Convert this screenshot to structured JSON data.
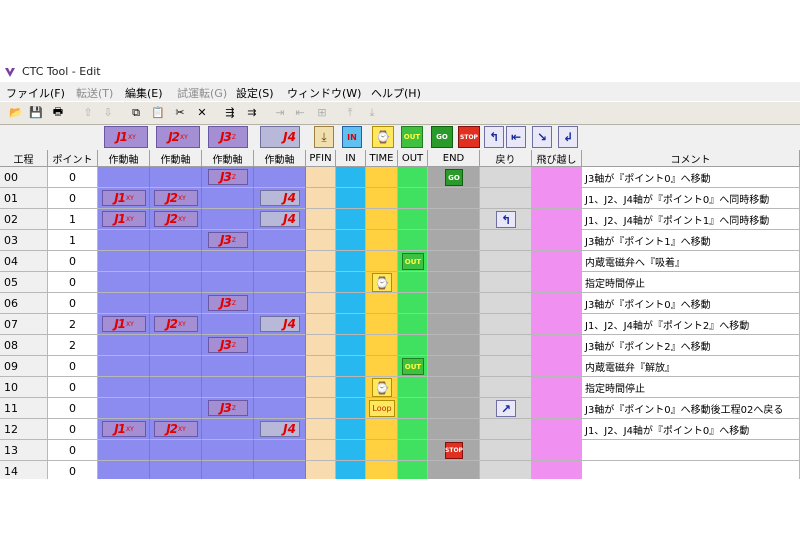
{
  "window": {
    "title": "CTC Tool - Edit"
  },
  "menu": [
    {
      "label": "ファイル(F)",
      "disabled": false
    },
    {
      "label": "転送(T)",
      "disabled": true
    },
    {
      "label": "編集(E)",
      "disabled": false
    },
    {
      "label": "試運転(G)",
      "disabled": true
    },
    {
      "label": "設定(S)",
      "disabled": false
    },
    {
      "label": "ウィンドウ(W)",
      "disabled": false
    },
    {
      "label": "ヘルプ(H)",
      "disabled": false
    }
  ],
  "toolbar": [
    {
      "name": "open-icon",
      "glyph": "📂",
      "disabled": false
    },
    {
      "name": "save-icon",
      "glyph": "💾",
      "disabled": false
    },
    {
      "name": "print-icon",
      "glyph": "🖶",
      "disabled": false
    },
    {
      "name": "move-up-icon",
      "glyph": "⇧",
      "disabled": true
    },
    {
      "name": "move-down-icon",
      "glyph": "⇩",
      "disabled": true
    },
    {
      "name": "copy-icon",
      "glyph": "⧉",
      "disabled": false
    },
    {
      "name": "paste-icon",
      "glyph": "📋",
      "disabled": true
    },
    {
      "name": "cut-icon",
      "glyph": "✂",
      "disabled": false
    },
    {
      "name": "delete-icon",
      "glyph": "✕",
      "disabled": false
    },
    {
      "name": "insert-row-icon",
      "glyph": "⇶",
      "disabled": false
    },
    {
      "name": "insert-col-icon",
      "glyph": "⇉",
      "disabled": false
    },
    {
      "name": "indent-icon",
      "glyph": "⇥",
      "disabled": true
    },
    {
      "name": "outdent-icon",
      "glyph": "⇤",
      "disabled": true
    },
    {
      "name": "merge-icon",
      "glyph": "⊞",
      "disabled": true
    },
    {
      "name": "align-top-icon",
      "glyph": "⤒",
      "disabled": true
    },
    {
      "name": "align-bottom-icon",
      "glyph": "⤓",
      "disabled": true
    }
  ],
  "palette": [
    {
      "name": "palette-j1",
      "type": "j",
      "text": "J1",
      "sub": "XY"
    },
    {
      "name": "palette-j2",
      "type": "j",
      "text": "J2",
      "sub": "XY"
    },
    {
      "name": "palette-j3",
      "type": "j",
      "text": "J3",
      "sub": "Z"
    },
    {
      "name": "palette-j4",
      "type": "j4",
      "text": "J4",
      "sub": ""
    },
    {
      "name": "palette-pfin",
      "type": "pfin",
      "text": "⤓",
      "sub": ""
    },
    {
      "name": "palette-in",
      "type": "in",
      "text": "IN",
      "sub": ""
    },
    {
      "name": "palette-time",
      "type": "time",
      "text": "⌚",
      "sub": ""
    },
    {
      "name": "palette-out",
      "type": "out",
      "text": "OUT",
      "sub": ""
    },
    {
      "name": "palette-go",
      "type": "go",
      "text": "GO",
      "sub": ""
    },
    {
      "name": "palette-stop",
      "type": "stop",
      "text": "STOP",
      "sub": ""
    },
    {
      "name": "palette-back",
      "type": "back",
      "text": "↰",
      "sub": ""
    },
    {
      "name": "palette-back2",
      "type": "back",
      "text": "⇤",
      "sub": ""
    },
    {
      "name": "palette-jump",
      "type": "jump",
      "text": "↘",
      "sub": ""
    },
    {
      "name": "palette-jump2",
      "type": "jump",
      "text": "↲",
      "sub": ""
    }
  ],
  "columns": [
    "工程",
    "ポイント",
    "作動軸",
    "作動軸",
    "作動軸",
    "作動軸",
    "PFIN",
    "IN",
    "TIME",
    "OUT",
    "END",
    "戻り",
    "飛び越し",
    "コメント"
  ],
  "rows": [
    {
      "step": "00",
      "point": "0",
      "j1": false,
      "j2": false,
      "j3": true,
      "j4": false,
      "time": "",
      "out": false,
      "end": "go",
      "back": "",
      "comment": "J3軸が『ポイント0』へ移動"
    },
    {
      "step": "01",
      "point": "0",
      "j1": true,
      "j2": true,
      "j3": false,
      "j4": true,
      "time": "",
      "out": false,
      "end": "",
      "back": "",
      "comment": "J1、J2、J4軸が『ポイント0』へ同時移動"
    },
    {
      "step": "02",
      "point": "1",
      "j1": true,
      "j2": true,
      "j3": false,
      "j4": true,
      "time": "",
      "out": false,
      "end": "",
      "back": "back",
      "comment": "J1、J2、J4軸が『ポイント1』へ同時移動"
    },
    {
      "step": "03",
      "point": "1",
      "j1": false,
      "j2": false,
      "j3": true,
      "j4": false,
      "time": "",
      "out": false,
      "end": "",
      "back": "",
      "comment": "J3軸が『ポイント1』へ移動"
    },
    {
      "step": "04",
      "point": "0",
      "j1": false,
      "j2": false,
      "j3": false,
      "j4": false,
      "time": "",
      "out": true,
      "end": "",
      "back": "",
      "comment": "内蔵電磁弁へ『吸着』"
    },
    {
      "step": "05",
      "point": "0",
      "j1": false,
      "j2": false,
      "j3": false,
      "j4": false,
      "time": "time",
      "out": false,
      "end": "",
      "back": "",
      "comment": "指定時間停止"
    },
    {
      "step": "06",
      "point": "0",
      "j1": false,
      "j2": false,
      "j3": true,
      "j4": false,
      "time": "",
      "out": false,
      "end": "",
      "back": "",
      "comment": "J3軸が『ポイント0』へ移動"
    },
    {
      "step": "07",
      "point": "2",
      "j1": true,
      "j2": true,
      "j3": false,
      "j4": true,
      "time": "",
      "out": false,
      "end": "",
      "back": "",
      "comment": "J1、J2、J4軸が『ポイント2』へ移動"
    },
    {
      "step": "08",
      "point": "2",
      "j1": false,
      "j2": false,
      "j3": true,
      "j4": false,
      "time": "",
      "out": false,
      "end": "",
      "back": "",
      "comment": "J3軸が『ポイント2』へ移動"
    },
    {
      "step": "09",
      "point": "0",
      "j1": false,
      "j2": false,
      "j3": false,
      "j4": false,
      "time": "",
      "out": true,
      "end": "",
      "back": "",
      "comment": "内蔵電磁弁『解放』"
    },
    {
      "step": "10",
      "point": "0",
      "j1": false,
      "j2": false,
      "j3": false,
      "j4": false,
      "time": "time",
      "out": false,
      "end": "",
      "back": "",
      "comment": "指定時間停止"
    },
    {
      "step": "11",
      "point": "0",
      "j1": false,
      "j2": false,
      "j3": true,
      "j4": false,
      "time": "loop",
      "out": false,
      "end": "",
      "back": "jump",
      "comment": "J3軸が『ポイント0』へ移動後工程02へ戻る"
    },
    {
      "step": "12",
      "point": "0",
      "j1": true,
      "j2": true,
      "j3": false,
      "j4": true,
      "time": "",
      "out": false,
      "end": "",
      "back": "",
      "comment": "J1、J2、J4軸が『ポイント0』へ移動"
    },
    {
      "step": "13",
      "point": "0",
      "j1": false,
      "j2": false,
      "j3": false,
      "j4": false,
      "time": "",
      "out": false,
      "end": "stop",
      "back": "",
      "comment": ""
    },
    {
      "step": "14",
      "point": "0",
      "j1": false,
      "j2": false,
      "j3": false,
      "j4": false,
      "time": "",
      "out": false,
      "end": "",
      "back": "",
      "comment": ""
    }
  ],
  "glyphs": {
    "j1": "J1",
    "j2": "J2",
    "j3": "J3",
    "j4": "J4",
    "xy": "XY",
    "z": "Z",
    "time": "⌚",
    "loop": "Loop",
    "out": "OUT",
    "go": "GO",
    "stop": "STOP",
    "back": "↰",
    "jump": "↗"
  }
}
